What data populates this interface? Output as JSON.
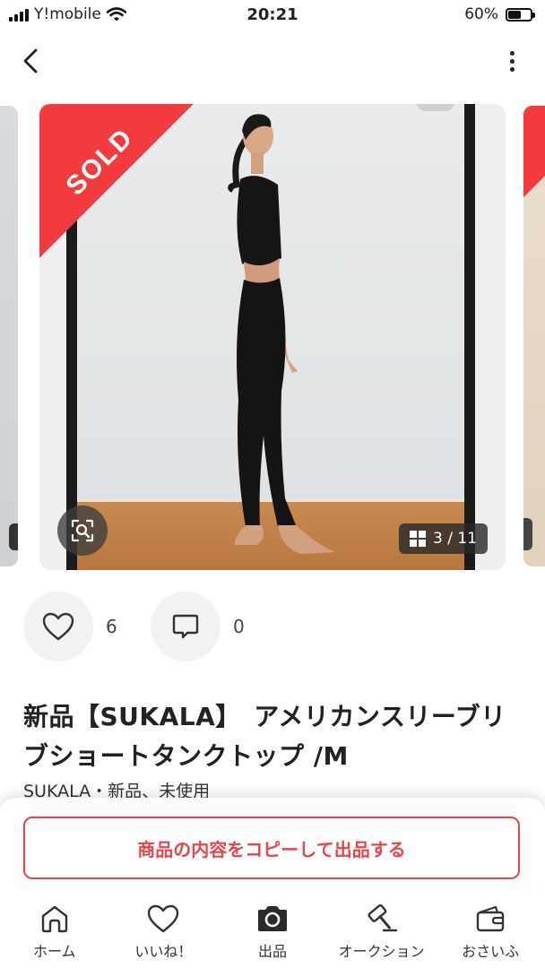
{
  "status_bar": {
    "carrier": "Y!mobile",
    "time": "20:21",
    "battery_percent": "60%",
    "battery_level": 0.6
  },
  "nav": {
    "back_icon": "chevron-left-icon",
    "more_icon": "more-vertical-icon"
  },
  "gallery": {
    "sold_label": "SOLD",
    "counter": "3 / 11",
    "current_index": 3,
    "total": 11
  },
  "actions": {
    "like_count": "6",
    "comment_count": "0"
  },
  "product": {
    "title": "新品【SUKALA】　アメリカンスリーブリブショートタンクトップ /M",
    "subtitle": "SUKALA・新品、未使用"
  },
  "cta": {
    "copy_label": "商品の内容をコピーして出品する"
  },
  "tabs": [
    {
      "label": "ホーム",
      "icon": "home-icon"
    },
    {
      "label": "いいね！",
      "icon": "heart-icon"
    },
    {
      "label": "出品",
      "icon": "camera-icon"
    },
    {
      "label": "オークション",
      "icon": "gavel-icon"
    },
    {
      "label": "おさいふ",
      "icon": "wallet-icon"
    }
  ],
  "colors": {
    "accent_red": "#e8454a",
    "sold_red": "#f23a3f"
  }
}
